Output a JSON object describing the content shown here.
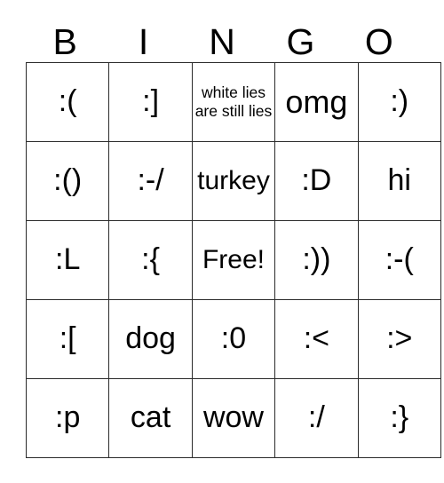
{
  "card": {
    "title_letters": [
      "B",
      "I",
      "N",
      "G",
      "O"
    ],
    "free_space_label": "Free!",
    "rows": [
      [
        {
          "text": ":(",
          "size": "normal"
        },
        {
          "text": ":]",
          "size": "normal"
        },
        {
          "text": "white lies are still lies",
          "size": "small"
        },
        {
          "text": "omg",
          "size": "large"
        },
        {
          "text": ":)",
          "size": "normal"
        }
      ],
      [
        {
          "text": ":()",
          "size": "normal"
        },
        {
          "text": ":-/",
          "size": "normal"
        },
        {
          "text": "turkey",
          "size": "medium"
        },
        {
          "text": ":D",
          "size": "normal"
        },
        {
          "text": "hi",
          "size": "normal"
        }
      ],
      [
        {
          "text": ":L",
          "size": "normal"
        },
        {
          "text": ":{",
          "size": "normal"
        },
        {
          "text": "Free!",
          "size": "medium"
        },
        {
          "text": ":))",
          "size": "normal"
        },
        {
          "text": ":-(",
          "size": "normal"
        }
      ],
      [
        {
          "text": ":[",
          "size": "normal"
        },
        {
          "text": "dog",
          "size": "normal"
        },
        {
          "text": ":0",
          "size": "normal"
        },
        {
          "text": ":<",
          "size": "normal"
        },
        {
          "text": ":>",
          "size": "normal"
        }
      ],
      [
        {
          "text": ":p",
          "size": "normal"
        },
        {
          "text": "cat",
          "size": "normal"
        },
        {
          "text": "wow",
          "size": "normal"
        },
        {
          "text": ":/",
          "size": "normal"
        },
        {
          "text": ":}",
          "size": "normal"
        }
      ]
    ],
    "colors": {
      "background": "#ffffff",
      "text": "#000000",
      "grid_line": "#2b2b2b"
    }
  }
}
